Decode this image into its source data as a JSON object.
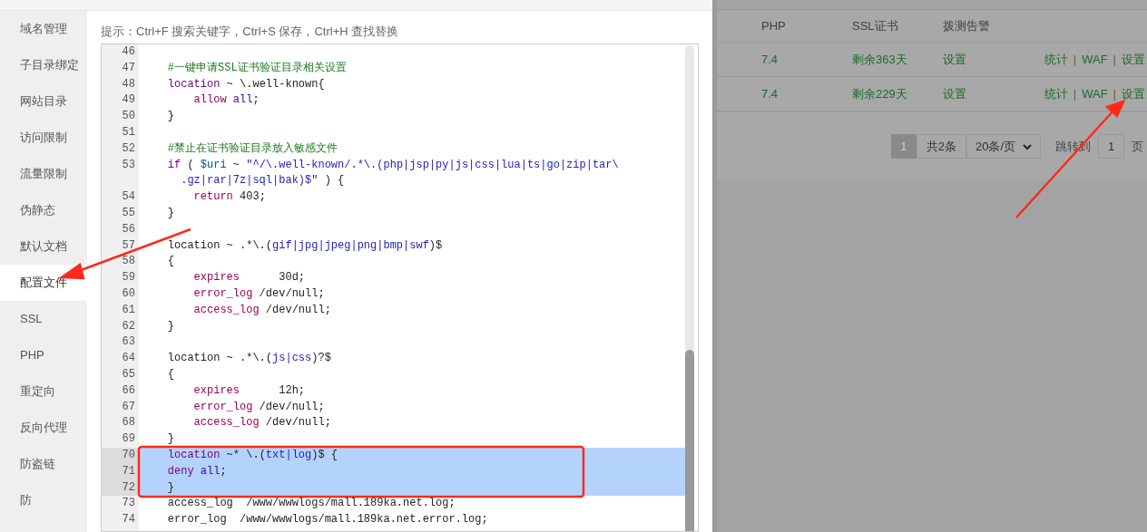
{
  "sidebar": {
    "items": [
      {
        "label": "域名管理",
        "selected": false
      },
      {
        "label": "子目录绑定",
        "selected": false
      },
      {
        "label": "网站目录",
        "selected": false
      },
      {
        "label": "访问限制",
        "selected": false
      },
      {
        "label": "流量限制",
        "selected": false
      },
      {
        "label": "伪静态",
        "selected": false
      },
      {
        "label": "默认文档",
        "selected": false
      },
      {
        "label": "配置文件",
        "selected": true
      },
      {
        "label": "SSL",
        "selected": false
      },
      {
        "label": "PHP",
        "selected": false
      },
      {
        "label": "重定向",
        "selected": false
      },
      {
        "label": "反向代理",
        "selected": false
      },
      {
        "label": "防盗链",
        "selected": false
      },
      {
        "label": "防",
        "selected": false
      }
    ]
  },
  "hint": "提示：Ctrl+F 搜索关键字，Ctrl+S 保存，Ctrl+H 查找替换",
  "editor": {
    "lines": [
      {
        "number": "46",
        "selected": false
      },
      {
        "number": "47",
        "selected": false,
        "segments": [
          {
            "text": "    #一键申请SSL证书验证目录相关设置",
            "kind": "comment"
          }
        ]
      },
      {
        "number": "48",
        "selected": false,
        "segments": [
          {
            "text": "    location",
            "kind": "keyword"
          },
          {
            "text": " ~ \\.well-known{"
          }
        ]
      },
      {
        "number": "49",
        "selected": false,
        "segments": [
          {
            "text": "        allow ",
            "kind": "directive"
          },
          {
            "text": "all",
            "kind": "atom"
          },
          {
            "text": ";"
          }
        ]
      },
      {
        "number": "50",
        "selected": false,
        "segments": [
          {
            "text": "    }"
          }
        ]
      },
      {
        "number": "51",
        "selected": false
      },
      {
        "number": "52",
        "selected": false,
        "segments": [
          {
            "text": "    #禁止在证书验证目录放入敏感文件",
            "kind": "comment"
          }
        ]
      },
      {
        "number": "53",
        "selected": false,
        "segments": [
          {
            "text": "    if",
            "kind": "keyword"
          },
          {
            "text": " ( "
          },
          {
            "text": "$uri",
            "kind": "variable"
          },
          {
            "text": " ~ "
          },
          {
            "text": "\"^/\\.well-known/.*\\.(php|jsp|py|js|css|lua|ts|go|zip|tar\\",
            "kind": "string"
          }
        ]
      },
      {
        "selected": false,
        "segments": [
          {
            "text": "      .gz|rar|7z|sql|bak)$\"",
            "kind": "string"
          },
          {
            "text": " ) {"
          }
        ]
      },
      {
        "number": "54",
        "selected": false,
        "segments": [
          {
            "text": "        return",
            "kind": "directive"
          },
          {
            "text": " 403;"
          }
        ]
      },
      {
        "number": "55",
        "selected": false,
        "segments": [
          {
            "text": "    }"
          }
        ]
      },
      {
        "number": "56",
        "selected": false
      },
      {
        "number": "57",
        "selected": false,
        "segments": [
          {
            "text": "    location ~ .*\\.("
          },
          {
            "text": "gif|jpg|jpeg|png|bmp|swf",
            "kind": "string"
          },
          {
            "text": ")$"
          }
        ]
      },
      {
        "number": "58",
        "selected": false,
        "segments": [
          {
            "text": "    {"
          }
        ]
      },
      {
        "number": "59",
        "selected": false,
        "segments": [
          {
            "text": "        expires",
            "kind": "directive"
          },
          {
            "text": "      30d;"
          }
        ]
      },
      {
        "number": "60",
        "selected": false,
        "segments": [
          {
            "text": "        error_log",
            "kind": "directive"
          },
          {
            "text": " /dev/null;"
          }
        ]
      },
      {
        "number": "61",
        "selected": false,
        "segments": [
          {
            "text": "        access_log",
            "kind": "directive"
          },
          {
            "text": " /dev/null;"
          }
        ]
      },
      {
        "number": "62",
        "selected": false,
        "segments": [
          {
            "text": "    }"
          }
        ]
      },
      {
        "number": "63",
        "selected": false
      },
      {
        "number": "64",
        "selected": false,
        "segments": [
          {
            "text": "    location ~ .*\\.("
          },
          {
            "text": "js|css",
            "kind": "string"
          },
          {
            "text": ")?$"
          }
        ]
      },
      {
        "number": "65",
        "selected": false,
        "segments": [
          {
            "text": "    {"
          }
        ]
      },
      {
        "number": "66",
        "selected": false,
        "segments": [
          {
            "text": "        expires",
            "kind": "directive"
          },
          {
            "text": "      12h;"
          }
        ]
      },
      {
        "number": "67",
        "selected": false,
        "segments": [
          {
            "text": "        error_log",
            "kind": "directive"
          },
          {
            "text": " /dev/null;"
          }
        ]
      },
      {
        "number": "68",
        "selected": false,
        "segments": [
          {
            "text": "        access_log",
            "kind": "directive"
          },
          {
            "text": " /dev/null;"
          }
        ]
      },
      {
        "number": "69",
        "selected": false,
        "segments": [
          {
            "text": "    }"
          }
        ]
      },
      {
        "number": "70",
        "selected": true,
        "segments": [
          {
            "text": "    location",
            "kind": "keyword"
          },
          {
            "text": " ~* \\.("
          },
          {
            "text": "txt|log",
            "kind": "string"
          },
          {
            "text": ")$ {"
          }
        ]
      },
      {
        "number": "71",
        "selected": true,
        "segments": [
          {
            "text": "    deny ",
            "kind": "keyword"
          },
          {
            "text": "all",
            "kind": "atom"
          },
          {
            "text": ";"
          }
        ]
      },
      {
        "number": "72",
        "selected": true,
        "segments": [
          {
            "text": "    }"
          }
        ]
      },
      {
        "number": "73",
        "selected": false,
        "segments": [
          {
            "text": "    access_log  /www/wwwlogs/mall.189ka.net.log;"
          }
        ]
      },
      {
        "number": "74",
        "selected": false,
        "segments": [
          {
            "text": "    error_log  /www/wwwlogs/mall.189ka.net.error.log;"
          }
        ]
      }
    ]
  },
  "background_page": {
    "columns": [
      "PHP",
      "SSL证书",
      "拨测告警"
    ],
    "rows": [
      {
        "php": "7.4",
        "ssl": "剩余363天",
        "monitor": "设置",
        "actions": [
          "统计",
          "WAF",
          "设置"
        ]
      },
      {
        "php": "7.4",
        "ssl": "剩余229天",
        "monitor": "设置",
        "actions": [
          "统计",
          "WAF",
          "设置"
        ]
      }
    ],
    "action_separator": "|",
    "pagination": {
      "current_page": "1",
      "total": "共2条",
      "page_size": "20条/页",
      "jump_label": "跳转到",
      "jump_value": "1",
      "page_suffix": "页"
    }
  }
}
